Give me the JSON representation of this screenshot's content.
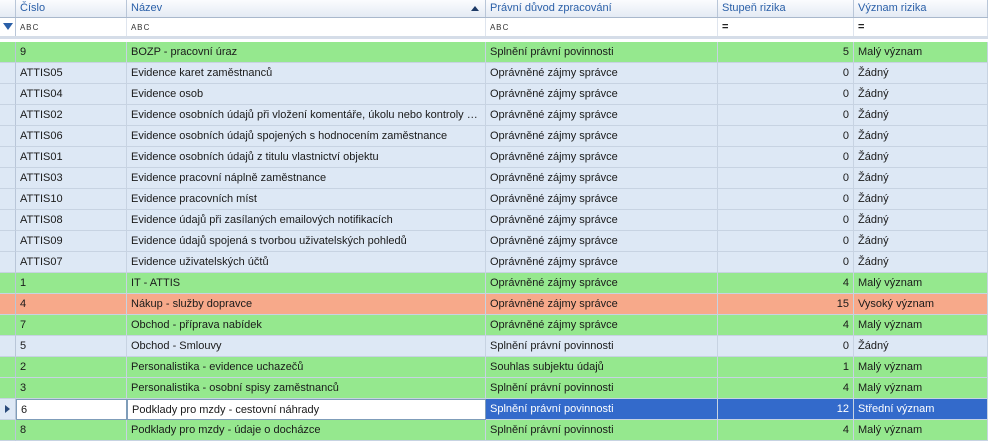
{
  "columns": {
    "cislo": "Číslo",
    "nazev": "Název",
    "pravni_duvod": "Právní důvod zpracování",
    "stupen_rizika": "Stupeň rizika",
    "vyznam_rizika": "Význam rizika"
  },
  "filter": {
    "abc_glyph": "A B C",
    "eq_glyph": "="
  },
  "rows": [
    {
      "cislo": "9",
      "nazev": "BOZP - pracovní úraz",
      "duvod": "Splnění právní povinnosti",
      "stupen": "5",
      "vyznam": "Malý význam",
      "color": "green"
    },
    {
      "cislo": "ATTIS05",
      "nazev": "Evidence karet zaměstnanců",
      "duvod": "Oprávněné zájmy správce",
      "stupen": "0",
      "vyznam": "Žádný",
      "color": "blue"
    },
    {
      "cislo": "ATTIS04",
      "nazev": "Evidence osob",
      "duvod": "Oprávněné zájmy správce",
      "stupen": "0",
      "vyznam": "Žádný",
      "color": "blue"
    },
    {
      "cislo": "ATTIS02",
      "nazev": "Evidence osobních údajů při vložení komentáře, úkolu nebo kontroly úk...",
      "duvod": "Oprávněné zájmy správce",
      "stupen": "0",
      "vyznam": "Žádný",
      "color": "blue"
    },
    {
      "cislo": "ATTIS06",
      "nazev": "Evidence osobních údajů spojených s hodnocením zaměstnance",
      "duvod": "Oprávněné zájmy správce",
      "stupen": "0",
      "vyznam": "Žádný",
      "color": "blue"
    },
    {
      "cislo": "ATTIS01",
      "nazev": "Evidence osobních údajů z titulu vlastnictví objektu",
      "duvod": "Oprávněné zájmy správce",
      "stupen": "0",
      "vyznam": "Žádný",
      "color": "blue"
    },
    {
      "cislo": "ATTIS03",
      "nazev": "Evidence pracovní náplně zaměstnance",
      "duvod": "Oprávněné zájmy správce",
      "stupen": "0",
      "vyznam": "Žádný",
      "color": "blue"
    },
    {
      "cislo": "ATTIS10",
      "nazev": "Evidence pracovních míst",
      "duvod": "Oprávněné zájmy správce",
      "stupen": "0",
      "vyznam": "Žádný",
      "color": "blue"
    },
    {
      "cislo": "ATTIS08",
      "nazev": "Evidence údajů při zasílaných emailových notifikacích",
      "duvod": "Oprávněné zájmy správce",
      "stupen": "0",
      "vyznam": "Žádný",
      "color": "blue"
    },
    {
      "cislo": "ATTIS09",
      "nazev": "Evidence údajů spojená s tvorbou uživatelských pohledů",
      "duvod": "Oprávněné zájmy správce",
      "stupen": "0",
      "vyznam": "Žádný",
      "color": "blue"
    },
    {
      "cislo": "ATTIS07",
      "nazev": "Evidence uživatelských účtů",
      "duvod": "Oprávněné zájmy správce",
      "stupen": "0",
      "vyznam": "Žádný",
      "color": "blue"
    },
    {
      "cislo": "1",
      "nazev": "IT - ATTIS",
      "duvod": "Oprávněné zájmy správce",
      "stupen": "4",
      "vyznam": "Malý význam",
      "color": "green"
    },
    {
      "cislo": "4",
      "nazev": "Nákup - služby dopravce",
      "duvod": "Oprávněné zájmy správce",
      "stupen": "15",
      "vyznam": "Vysoký význam",
      "color": "orange"
    },
    {
      "cislo": "7",
      "nazev": "Obchod - příprava nabídek",
      "duvod": "Oprávněné zájmy správce",
      "stupen": "4",
      "vyznam": "Malý význam",
      "color": "green"
    },
    {
      "cislo": "5",
      "nazev": "Obchod - Smlouvy",
      "duvod": "Splnění právní povinnosti",
      "stupen": "0",
      "vyznam": "Žádný",
      "color": "blue"
    },
    {
      "cislo": "2",
      "nazev": "Personalistika - evidence uchazečů",
      "duvod": "Souhlas subjektu údajů",
      "stupen": "1",
      "vyznam": "Malý význam",
      "color": "green"
    },
    {
      "cislo": "3",
      "nazev": "Personalistika - osobní spisy zaměstnanců",
      "duvod": "Splnění právní povinnosti",
      "stupen": "4",
      "vyznam": "Malý význam",
      "color": "green"
    },
    {
      "cislo": "6",
      "nazev": "Podklady pro mzdy - cestovní náhrady",
      "duvod": "Splnění právní povinnosti",
      "stupen": "12",
      "vyznam": "Střední význam",
      "color": "selected"
    },
    {
      "cislo": "8",
      "nazev": "Podklady pro mzdy - údaje o docházce",
      "duvod": "Splnění právní povinnosti",
      "stupen": "4",
      "vyznam": "Malý význam",
      "color": "green"
    }
  ],
  "colors": {
    "green": "#95e88e",
    "blue": "#dde8f5",
    "orange": "#f7a98a",
    "selected": "#336acb"
  }
}
